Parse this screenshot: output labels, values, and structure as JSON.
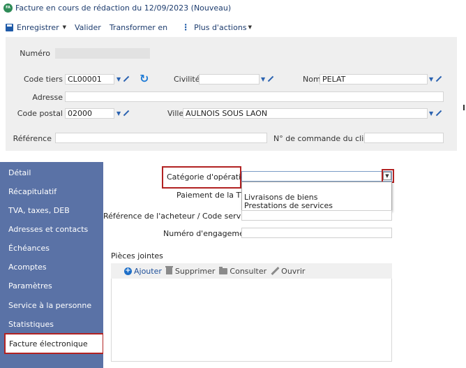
{
  "window": {
    "badge": "FA",
    "title": "Facture en cours de rédaction du 12/09/2023 (Nouveau)"
  },
  "toolbar": {
    "save_label": "Enregistrer",
    "validate_label": "Valider",
    "transform_label": "Transformer en",
    "more_actions_label": "Plus d'actions"
  },
  "header": {
    "numero": {
      "label": "Numéro",
      "value": ""
    },
    "code_tiers": {
      "label": "Code tiers",
      "value": "CL00001"
    },
    "civilite": {
      "label": "Civilité",
      "value": ""
    },
    "nom": {
      "label": "Nom",
      "value": "PELAT"
    },
    "adresse": {
      "label": "Adresse",
      "value": ""
    },
    "code_postal": {
      "label": "Code postal",
      "value": "02000"
    },
    "ville": {
      "label": "Ville",
      "value": "AULNOIS SOUS LAON"
    },
    "reference": {
      "label": "Référence",
      "value": ""
    },
    "commande": {
      "label": "N° de commande du client",
      "value": ""
    }
  },
  "sidebar": {
    "items": [
      {
        "label": "Détail"
      },
      {
        "label": "Récapitulatif"
      },
      {
        "label": "TVA, taxes, DEB"
      },
      {
        "label": "Adresses et contacts"
      },
      {
        "label": "Échéances"
      },
      {
        "label": "Acomptes"
      },
      {
        "label": "Paramètres"
      },
      {
        "label": "Service à la personne"
      },
      {
        "label": "Statistiques"
      },
      {
        "label": "Facture électronique"
      }
    ],
    "active_index": 9
  },
  "main": {
    "categorie_label": "Catégorie d'opérations",
    "categorie_value": "",
    "categorie_options": [
      "Livraisons de biens",
      "Prestations de services"
    ],
    "paiement_label": "Paiement de la TVA",
    "reference_acheteur_label": "Référence de l'acheteur / Code service",
    "engagement_label": "Numéro d'engagement",
    "attachments_title": "Pièces jointes",
    "attach_add": "Ajouter",
    "attach_delete": "Supprimer",
    "attach_view": "Consulter",
    "attach_open": "Ouvrir"
  },
  "colors": {
    "sidebar_bg": "#5a72a6",
    "highlight": "#b22222",
    "accent": "#1e5aa8",
    "panel_bg": "#efefef"
  }
}
